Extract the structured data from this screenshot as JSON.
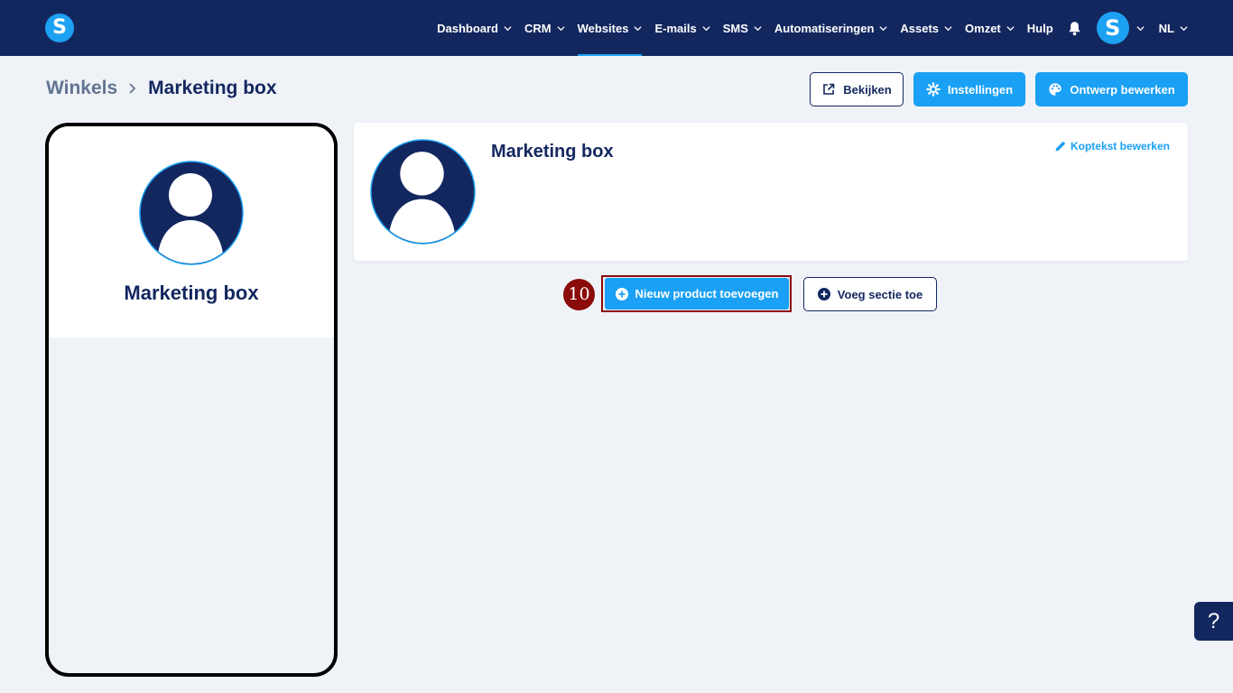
{
  "brand": {
    "logo_letter": "S",
    "accent": "#1aa0f4",
    "navy": "#13275f"
  },
  "nav": {
    "items": [
      {
        "label": "Dashboard",
        "dropdown": true
      },
      {
        "label": "CRM",
        "dropdown": true
      },
      {
        "label": "Websites",
        "dropdown": true,
        "active": true
      },
      {
        "label": "E-mails",
        "dropdown": true
      },
      {
        "label": "SMS",
        "dropdown": true
      },
      {
        "label": "Automatiseringen",
        "dropdown": true
      },
      {
        "label": "Assets",
        "dropdown": true
      },
      {
        "label": "Omzet",
        "dropdown": true
      },
      {
        "label": "Hulp",
        "dropdown": false
      }
    ],
    "avatar_letter": "S",
    "language": "NL"
  },
  "breadcrumb": {
    "parent": "Winkels",
    "current": "Marketing box"
  },
  "header_actions": {
    "view": "Bekijken",
    "settings": "Instellingen",
    "edit_design": "Ontwerp bewerken"
  },
  "preview": {
    "shop_name": "Marketing box"
  },
  "header_card": {
    "title": "Marketing box",
    "edit_header": "Koptekst bewerken"
  },
  "actions": {
    "step_number": "10",
    "add_product": "Nieuw product toevoegen",
    "add_section": "Voeg sectie toe"
  },
  "help": {
    "label": "?"
  },
  "icons": [
    "chevron-down-icon",
    "bell-icon",
    "chevron-right-icon",
    "external-link-icon",
    "gear-icon",
    "palette-icon",
    "user-placeholder-icon",
    "pencil-icon",
    "plus-circle-icon"
  ]
}
